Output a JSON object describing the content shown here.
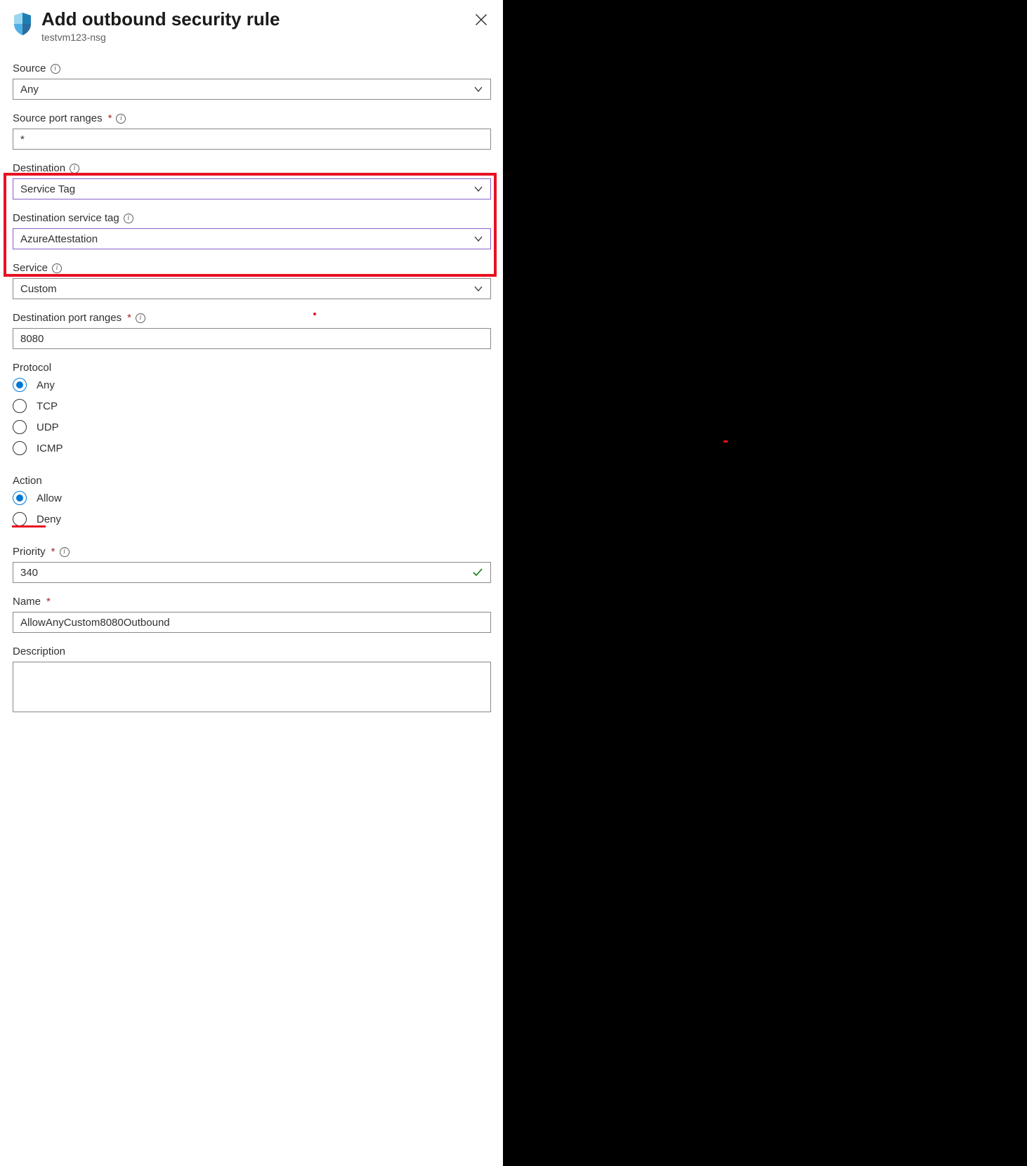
{
  "header": {
    "title": "Add outbound security rule",
    "subtitle": "testvm123-nsg"
  },
  "fields": {
    "source": {
      "label": "Source",
      "value": "Any"
    },
    "source_port_ranges": {
      "label": "Source port ranges",
      "value": "*"
    },
    "destination": {
      "label": "Destination",
      "value": "Service Tag"
    },
    "destination_service_tag": {
      "label": "Destination service tag",
      "value": "AzureAttestation"
    },
    "service": {
      "label": "Service",
      "value": "Custom"
    },
    "destination_port_ranges": {
      "label": "Destination port ranges",
      "value": "8080"
    },
    "protocol": {
      "label": "Protocol",
      "options": [
        "Any",
        "TCP",
        "UDP",
        "ICMP"
      ],
      "selected": "Any"
    },
    "action": {
      "label": "Action",
      "options": [
        "Allow",
        "Deny"
      ],
      "selected": "Allow"
    },
    "priority": {
      "label": "Priority",
      "value": "340"
    },
    "name": {
      "label": "Name",
      "value": "AllowAnyCustom8080Outbound"
    },
    "description": {
      "label": "Description",
      "value": ""
    }
  }
}
